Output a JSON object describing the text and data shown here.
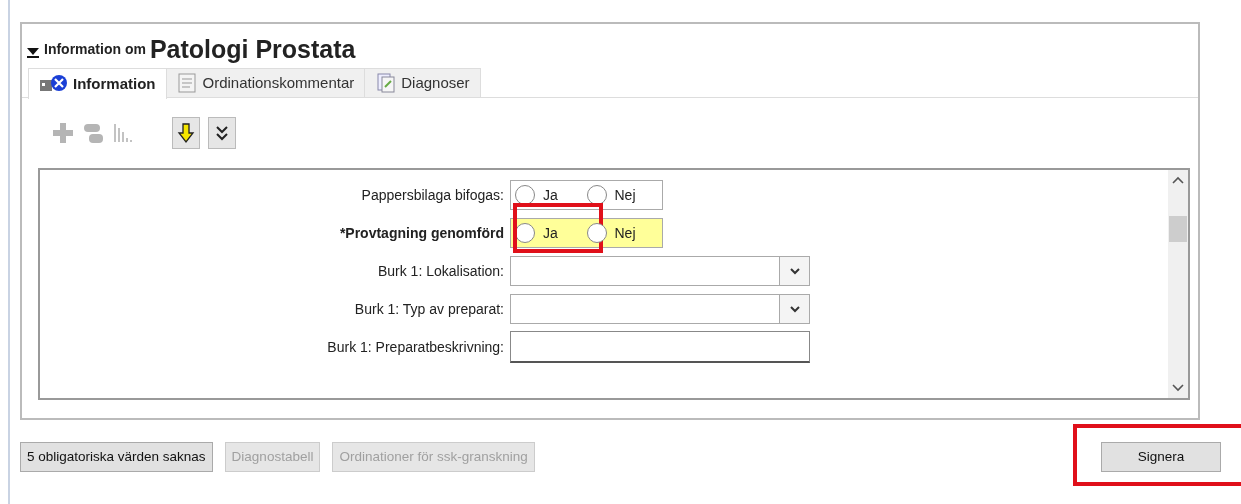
{
  "header": {
    "prefix": "Information om",
    "title": "Patologi Prostata",
    "expanded": true
  },
  "tabs": [
    {
      "label": "Information",
      "selected": true,
      "kind": "info"
    },
    {
      "label": "Ordinationskommentar",
      "selected": false,
      "kind": "comment"
    },
    {
      "label": "Diagnoser",
      "selected": false,
      "kind": "diagnosis"
    }
  ],
  "toolbar": [
    {
      "kind": "add",
      "disabled": true
    },
    {
      "kind": "link",
      "disabled": true
    },
    {
      "kind": "chart",
      "disabled": true
    },
    {
      "kind": "down",
      "disabled": false
    },
    {
      "kind": "expand",
      "disabled": false
    }
  ],
  "fields": [
    {
      "kind": "radio",
      "label": "Pappersbilaga bifogas:",
      "required": false,
      "options": [
        {
          "label": "Ja",
          "selected": false,
          "highlighted": false
        },
        {
          "label": "Nej",
          "selected": false,
          "highlighted": false
        }
      ]
    },
    {
      "kind": "radio",
      "label": "*Provtagning genomförd",
      "required": true,
      "options": [
        {
          "label": "Ja",
          "selected": false,
          "highlighted": true
        },
        {
          "label": "Nej",
          "selected": false,
          "highlighted": false
        }
      ]
    },
    {
      "kind": "dropdown",
      "label": "Burk 1: Lokalisation:",
      "required": false
    },
    {
      "kind": "dropdown",
      "label": "Burk 1: Typ av preparat:",
      "required": false
    },
    {
      "kind": "text",
      "label": "Burk 1: Preparatbeskrivning:",
      "required": false
    }
  ],
  "buttons": [
    {
      "label": "5 obligatoriska värden saknas",
      "disabled": false
    },
    {
      "label": "Diagnostabell",
      "disabled": true
    },
    {
      "label": "Ordinationer för ssk-granskning",
      "disabled": true
    }
  ],
  "sign_button": {
    "label": "Signera",
    "highlighted": true
  }
}
